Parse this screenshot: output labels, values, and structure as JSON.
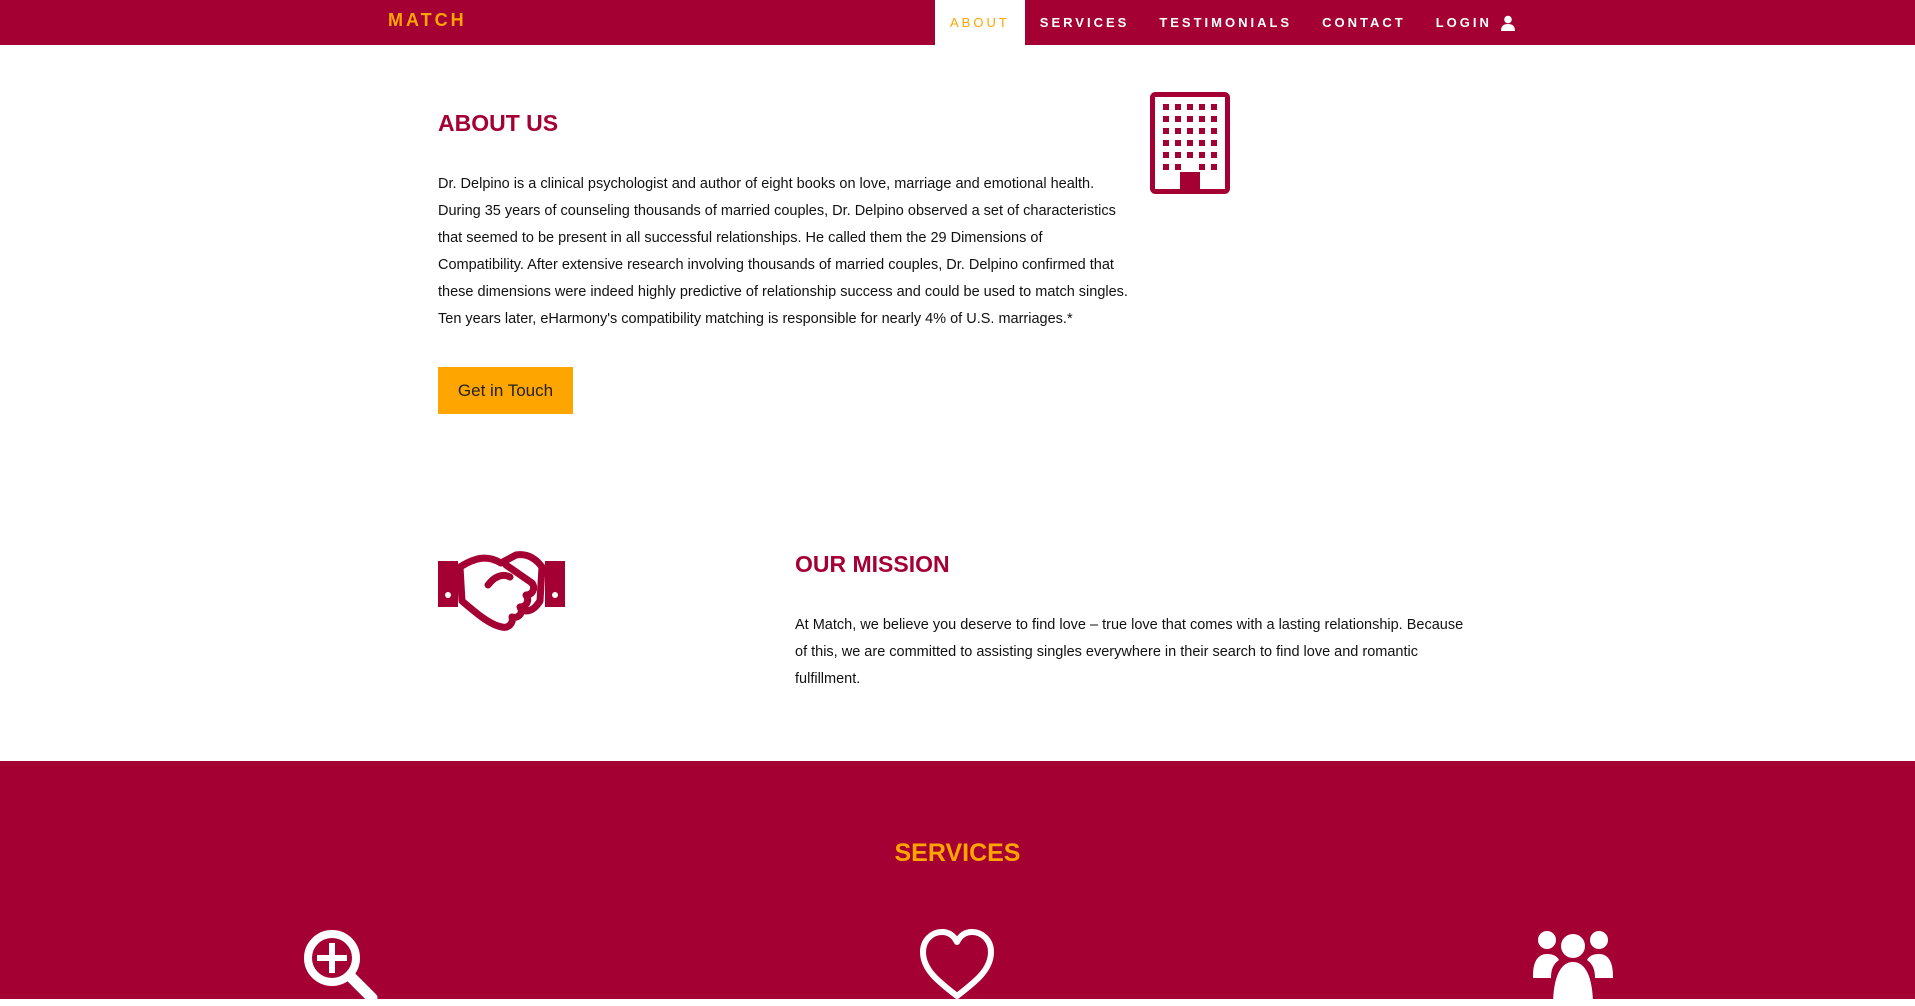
{
  "navbar": {
    "brand": "MATCH",
    "items": [
      {
        "label": "ABOUT",
        "active": true
      },
      {
        "label": "SERVICES",
        "active": false
      },
      {
        "label": "TESTIMONIALS",
        "active": false
      },
      {
        "label": "CONTACT",
        "active": false
      },
      {
        "label": "LOGIN",
        "active": false,
        "icon": "user-icon"
      }
    ]
  },
  "about": {
    "title": "ABOUT US",
    "text": "Dr. Delpino is a clinical psychologist and author of eight books on love, marriage and emotional health. During 35 years of counseling thousands of married couples, Dr. Delpino observed a set of characteristics that seemed to be present in all successful relationships. He called them the 29 Dimensions of Compatibility. After extensive research involving thousands of married couples, Dr. Delpino confirmed that these dimensions were indeed highly predictive of relationship success and could be used to match singles. Ten years later, eHarmony's compatibility matching is responsible for nearly 4% of U.S. marriages.*",
    "button_label": "Get in Touch",
    "icon": "building-icon"
  },
  "mission": {
    "title": "OUR MISSION",
    "text": "At Match, we believe you deserve to find love – true love that comes with a lasting relationship. Because of this, we are committed to assisting singles everywhere in their search to find love and romantic fulfillment.",
    "icon": "handshake-icon"
  },
  "services": {
    "title": "SERVICES",
    "icons": [
      "search-plus-icon",
      "heart-icon",
      "group-icon"
    ]
  },
  "colors": {
    "brand_primary": "#a50034",
    "accent": "#ffa500",
    "text": "#111111",
    "background": "#ffffff"
  }
}
